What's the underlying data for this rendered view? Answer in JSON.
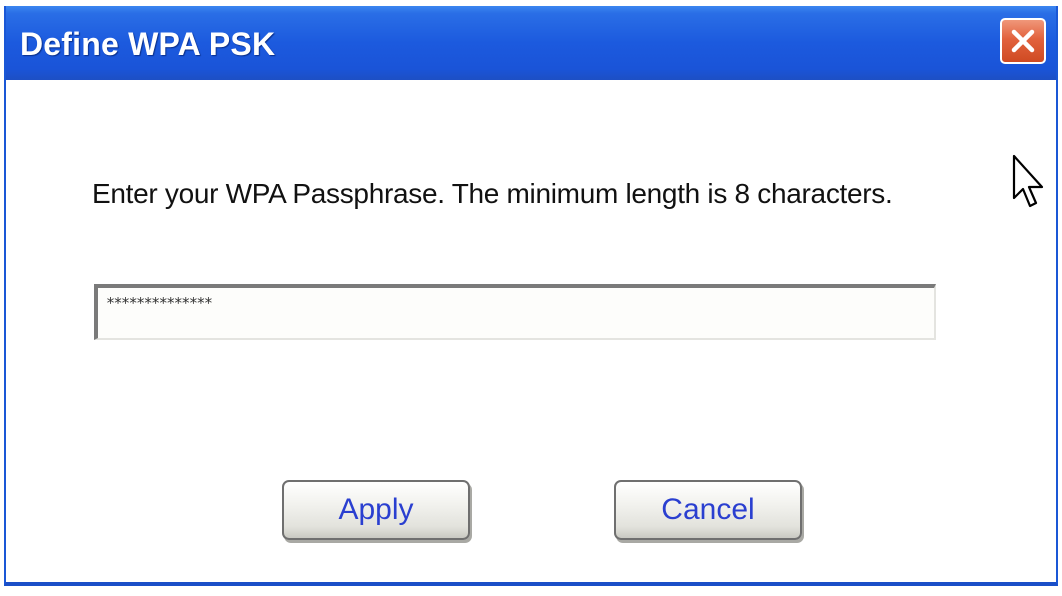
{
  "window": {
    "title": "Define WPA PSK"
  },
  "dialog": {
    "instruction": "Enter your WPA Passphrase.  The minimum length is 8 characters.",
    "passphrase_value": "**************"
  },
  "buttons": {
    "apply_label": "Apply",
    "cancel_label": "Cancel"
  },
  "icons": {
    "close": "close-icon",
    "cursor": "mouse-pointer-icon"
  },
  "colors": {
    "titlebar": "#1c5ade",
    "close_button": "#e2623d",
    "button_text": "#2a3fd0"
  }
}
